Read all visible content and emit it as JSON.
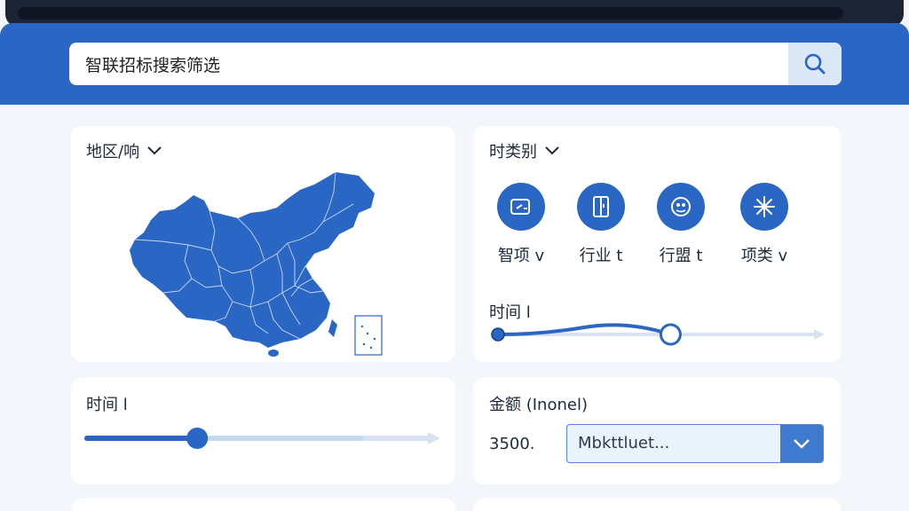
{
  "search": {
    "value": "智联招标搜索筛选"
  },
  "region_card": {
    "title": "地区/响"
  },
  "type_card": {
    "title": "时类别",
    "categories": [
      {
        "label": "智项 v",
        "icon": "edit-icon"
      },
      {
        "label": "行业 t",
        "icon": "book-icon"
      },
      {
        "label": "行盟 t",
        "icon": "group-icon"
      },
      {
        "label": "项类 v",
        "icon": "snowflake-icon"
      }
    ],
    "time_label": "时间 l",
    "slider_value": 0.54
  },
  "time_card": {
    "title": "时间 l",
    "slider_value": 0.32
  },
  "amount_card": {
    "title": "金额 (Inonel)",
    "amount_value": "3500.",
    "dropdown_value": "Mbkttluet..."
  },
  "colors": {
    "primary": "#2a66c4",
    "header": "#2a66c4",
    "track": "#d6e2f2"
  }
}
